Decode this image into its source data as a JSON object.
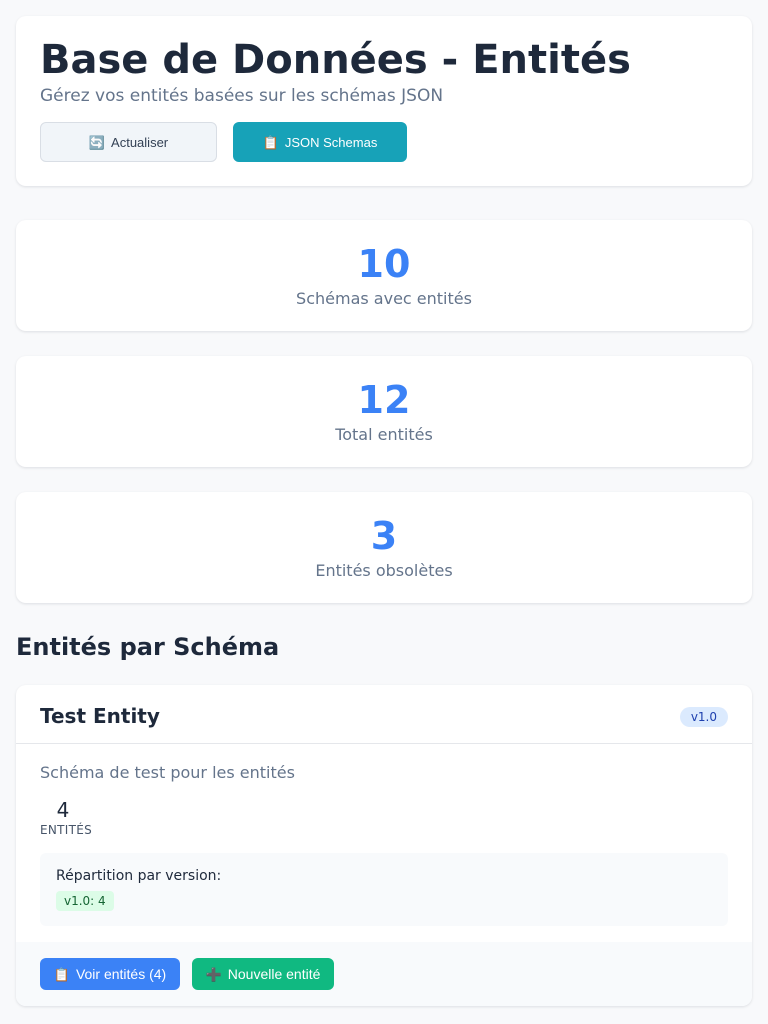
{
  "header": {
    "title": "Base de Données - Entités",
    "subtitle": "Gérez vos entités basées sur les schémas JSON",
    "refresh_icon": "🔄",
    "refresh_label": "Actualiser",
    "schemas_icon": "📋",
    "schemas_label": "JSON Schemas"
  },
  "stats": [
    {
      "value": "10",
      "label": "Schémas avec entités"
    },
    {
      "value": "12",
      "label": "Total entités"
    },
    {
      "value": "3",
      "label": "Entités obsolètes"
    }
  ],
  "section_title": "Entités par Schéma",
  "schema": {
    "name": "Test Entity",
    "version": "v1.0",
    "description": "Schéma de test pour les entités",
    "entity_count": "4",
    "entity_unit": "ENTITÉS",
    "version_breakdown_title": "Répartition par version:",
    "version_chips": [
      "v1.0: 4"
    ],
    "view_icon": "📋",
    "view_label": "Voir entités (4)",
    "new_icon": "➕",
    "new_label": "Nouvelle entité"
  },
  "colors": {
    "accent_blue": "#3b82f6",
    "teal": "#17a2b8",
    "green": "#10b981",
    "badge_blue_bg": "#dbeafe",
    "chip_green_bg": "#dcfce7"
  }
}
